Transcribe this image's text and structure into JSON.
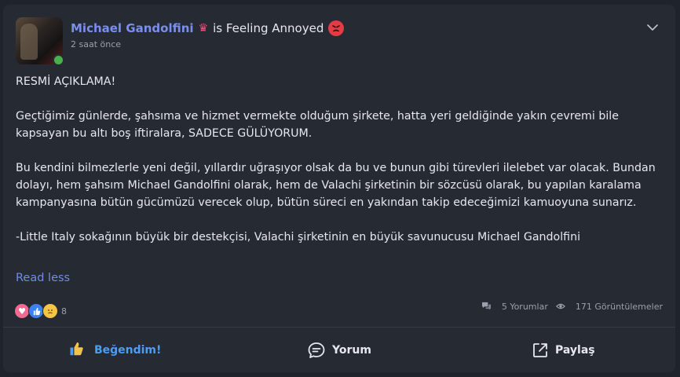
{
  "post": {
    "author": "Michael Gandolfini",
    "feeling_text": "is Feeling Annoyed",
    "time": "2 saat önce",
    "body": {
      "heading": "RESMİ AÇIKLAMA!",
      "p1": "Geçtiğimiz günlerde, şahsıma ve hizmet vermekte olduğum şirkete, hatta yeri geldiğinde yakın çevremi bile kapsayan bu altı boş iftiralara, SADECE GÜLÜYORUM.",
      "p2": "Bu kendini bilmezlerle yeni değil, yıllardır uğraşıyor olsak da bu ve bunun gibi türevleri ilelebet var olacak. Bundan dolayı, hem şahsım Michael Gandolfini olarak, hem de Valachi şirketinin bir sözcüsü olarak, bu yapılan karalama kampanyasına bütün gücümüzü verecek olup, bütün süreci en yakından takip edeceğimizi kamuoyuna sunarız.",
      "p3": "-Little Italy sokağının büyük bir destekçisi, Valachi şirketinin en büyük savunucusu Michael Gandolfini"
    },
    "read_less": "Read less",
    "reactions": {
      "count": "8",
      "icons": [
        "heart-icon",
        "thumbs-up-icon",
        "sad-face-icon"
      ]
    },
    "comments": "5 Yorumlar",
    "views": "171 Görüntülemeler"
  },
  "actions": {
    "like": "Beğendim!",
    "comment": "Yorum",
    "share": "Paylaş"
  },
  "colors": {
    "author": "#7a8ef0",
    "link": "#6f8de8",
    "liked": "#4e9cf5",
    "card": "#252a33",
    "background": "#1f232b"
  }
}
